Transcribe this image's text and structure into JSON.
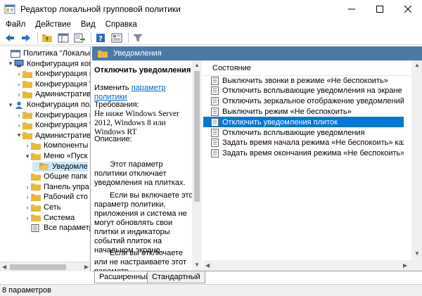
{
  "window": {
    "title": "Редактор локальной групповой политики"
  },
  "menu": {
    "items": [
      "Файл",
      "Действие",
      "Вид",
      "Справка"
    ]
  },
  "toolbar": {
    "icons": [
      "back-icon",
      "forward-icon",
      "up-folder-icon",
      "show-hide-tree-icon",
      "export-list-icon",
      "help-icon",
      "properties-icon",
      "filter-icon"
    ]
  },
  "tree": {
    "items": [
      {
        "label": "Политика \"Локальный",
        "level": 0,
        "arrow": "",
        "icon": "policy"
      },
      {
        "label": "Конфигурация комп",
        "level": 1,
        "arrow": "▾",
        "icon": "computer"
      },
      {
        "label": "Конфигурация п",
        "level": 2,
        "arrow": "›",
        "icon": "folder"
      },
      {
        "label": "Конфигурация V",
        "level": 2,
        "arrow": "›",
        "icon": "folder"
      },
      {
        "label": "Административн",
        "level": 2,
        "arrow": "›",
        "icon": "folder"
      },
      {
        "label": "Конфигурация поль",
        "level": 1,
        "arrow": "▾",
        "icon": "user"
      },
      {
        "label": "Конфигурация п",
        "level": 2,
        "arrow": "›",
        "icon": "folder"
      },
      {
        "label": "Конфигурация V",
        "level": 2,
        "arrow": "›",
        "icon": "folder"
      },
      {
        "label": "Административн",
        "level": 2,
        "arrow": "▾",
        "icon": "folder"
      },
      {
        "label": "Компоненты",
        "level": 3,
        "arrow": "›",
        "icon": "folder"
      },
      {
        "label": "Меню «Пуск",
        "level": 3,
        "arrow": "▾",
        "icon": "folder"
      },
      {
        "label": "Уведомле",
        "level": 4,
        "arrow": "",
        "icon": "folder-open",
        "selected": true
      },
      {
        "label": "Общие папк",
        "level": 3,
        "arrow": "",
        "icon": "folder"
      },
      {
        "label": "Панель упра",
        "level": 3,
        "arrow": "›",
        "icon": "folder"
      },
      {
        "label": "Рабочий сто",
        "level": 3,
        "arrow": "›",
        "icon": "folder"
      },
      {
        "label": "Сеть",
        "level": 3,
        "arrow": "›",
        "icon": "folder"
      },
      {
        "label": "Система",
        "level": 3,
        "arrow": "›",
        "icon": "folder"
      },
      {
        "label": "Все параметр",
        "level": 3,
        "arrow": "",
        "icon": "all-settings"
      }
    ]
  },
  "right_header": {
    "title": "Уведомления"
  },
  "description": {
    "title": "Отключить уведомления плиток",
    "edit_prefix": "Изменить ",
    "edit_link": "параметр политики",
    "req_label": "Требования:",
    "req_text": "Не ниже Windows Server 2012, Windows 8 или Windows RT",
    "desc_label": "Описание:",
    "para1": "Этот параметр политики отключает уведомления на плитках.",
    "para2": "Если вы включаете этот параметр политики, приложения и система не могут обновлять свои плитки и индикаторы событий плиток на начальном экране.",
    "para3": "Если вы отключаете или не настраиваете этот параметр"
  },
  "list": {
    "column_header": "Состояние",
    "items": [
      {
        "label": "Выключить звонки в режиме «Не беспокоить»"
      },
      {
        "label": "Отключить всплывающие уведомления на экране блоки..."
      },
      {
        "label": "Отключить зеркальное отображение уведомлений"
      },
      {
        "label": "Выключить режим «Не беспокоить»"
      },
      {
        "label": "Отключить уведомления плиток",
        "selected": true
      },
      {
        "label": "Отключить всплывающие уведомления"
      },
      {
        "label": "Задать время начала режима «Не беспокоить» каждый д..."
      },
      {
        "label": "Задать время окончания режима «Не беспокоить» кажд..."
      }
    ]
  },
  "tabs": {
    "extended": "Расширенный",
    "standard": "Стандартный"
  },
  "status": {
    "text": "8 параметров"
  },
  "colors": {
    "header_bg": "#4a7aa5",
    "selection": "#0078d7",
    "tree_selection": "#cce8ff",
    "folder": "#e8b93a",
    "link": "#0066cc"
  }
}
